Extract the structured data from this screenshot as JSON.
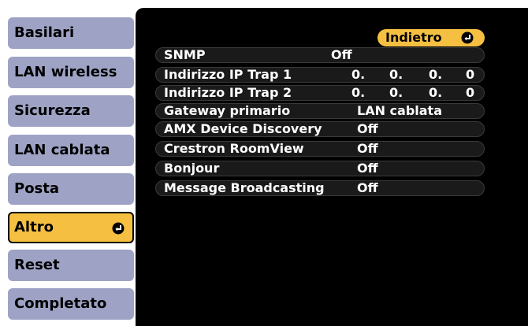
{
  "sidebar": {
    "items": [
      {
        "label": "Basilari"
      },
      {
        "label": "LAN wireless"
      },
      {
        "label": "Sicurezza"
      },
      {
        "label": "LAN cablata"
      },
      {
        "label": "Posta"
      },
      {
        "label": "Altro",
        "active": true
      },
      {
        "label": "Reset"
      },
      {
        "label": "Completato"
      }
    ]
  },
  "back_button": {
    "label": "Indietro"
  },
  "settings": {
    "snmp": {
      "label": "SNMP",
      "value": "Off"
    },
    "trap1": {
      "label": "Indirizzo IP Trap 1",
      "octets": [
        "0.",
        "0.",
        "0.",
        "0"
      ]
    },
    "trap2": {
      "label": "Indirizzo IP Trap 2",
      "octets": [
        "0.",
        "0.",
        "0.",
        "0"
      ]
    },
    "gateway": {
      "label": "Gateway primario",
      "value": "LAN cablata"
    },
    "amx": {
      "label": "AMX Device Discovery",
      "value": "Off"
    },
    "crestron": {
      "label": "Crestron RoomView",
      "value": "Off"
    },
    "bonjour": {
      "label": "Bonjour",
      "value": "Off"
    },
    "broadcast": {
      "label": "Message Broadcasting",
      "value": "Off"
    }
  },
  "colors": {
    "accent": "#f5c042",
    "sidebar": "#9ea3c5",
    "panel": "#000000"
  },
  "icons": {
    "enter": "enter-icon"
  }
}
